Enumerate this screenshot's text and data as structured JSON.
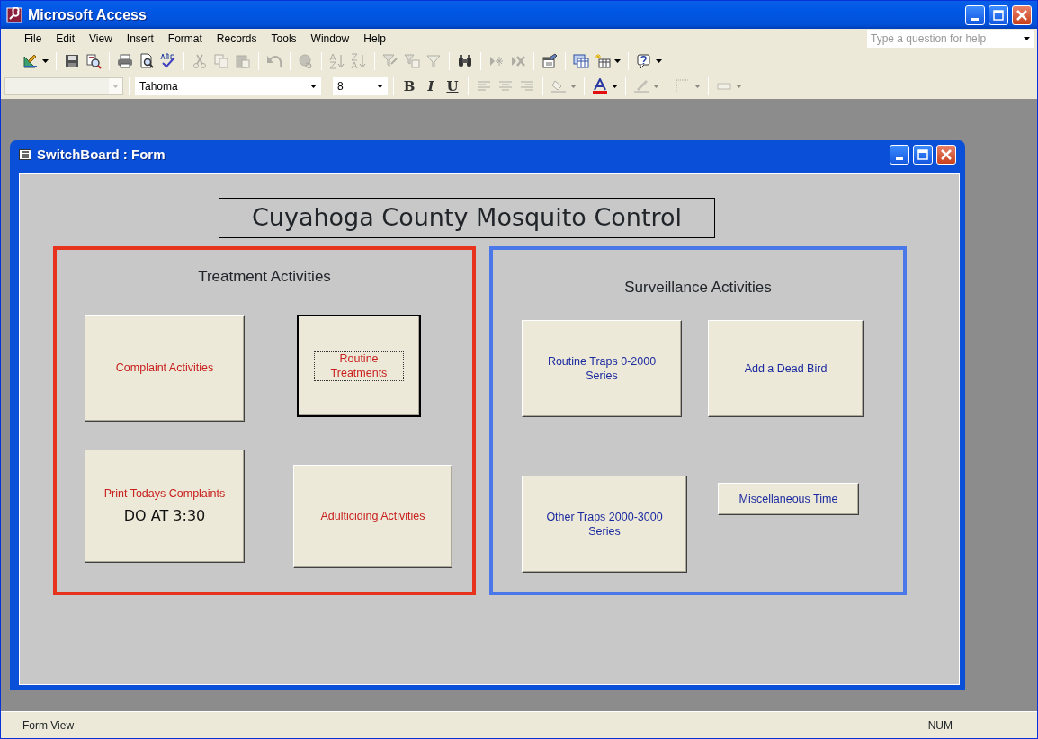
{
  "window": {
    "title": "Microsoft Access"
  },
  "menu": [
    "File",
    "Edit",
    "View",
    "Insert",
    "Format",
    "Records",
    "Tools",
    "Window",
    "Help"
  ],
  "help_box": {
    "placeholder": "Type a question for help"
  },
  "toolbar": {
    "groups": [
      [
        {
          "kind": "design",
          "disabled": false
        }
      ],
      [
        {
          "kind": "save",
          "disabled": false
        },
        {
          "kind": "filesearch",
          "disabled": false
        }
      ],
      [
        {
          "kind": "print",
          "disabled": false
        },
        {
          "kind": "preview",
          "disabled": false
        },
        {
          "kind": "spelling",
          "disabled": false
        }
      ],
      [
        {
          "kind": "cut",
          "disabled": true
        },
        {
          "kind": "copy",
          "disabled": true
        },
        {
          "kind": "paste",
          "disabled": true
        }
      ],
      [
        {
          "kind": "undo",
          "disabled": true
        }
      ],
      [
        {
          "kind": "hyperlink",
          "disabled": true
        }
      ],
      [
        {
          "kind": "sortasc",
          "disabled": true
        },
        {
          "kind": "sortdesc",
          "disabled": true
        }
      ],
      [
        {
          "kind": "filtersel",
          "disabled": true
        },
        {
          "kind": "filterform",
          "disabled": true
        },
        {
          "kind": "filter",
          "disabled": true
        }
      ],
      [
        {
          "kind": "find",
          "disabled": false
        }
      ],
      [
        {
          "kind": "newrecord",
          "disabled": true
        },
        {
          "kind": "deleterecord",
          "disabled": true
        }
      ],
      [
        {
          "kind": "properties",
          "disabled": false
        }
      ],
      [
        {
          "kind": "dbwindow",
          "disabled": false
        },
        {
          "kind": "newobject",
          "disabled": false
        }
      ],
      [
        {
          "kind": "help",
          "disabled": false
        }
      ]
    ]
  },
  "format_toolbar": {
    "object_box": {
      "disabled": true
    },
    "font_box": {
      "value": "Tahoma"
    },
    "size_box": {
      "value": "8"
    },
    "style_buttons": [
      "B",
      "I",
      "U"
    ],
    "groups": [
      [
        {
          "kind": "alignleft",
          "disabled": true
        },
        {
          "kind": "aligncenter",
          "disabled": true
        },
        {
          "kind": "alignright",
          "disabled": true
        }
      ],
      [
        {
          "kind": "fillcolor",
          "disabled": true
        }
      ],
      [
        {
          "kind": "fontcolor",
          "disabled": false
        }
      ],
      [
        {
          "kind": "linecolor",
          "disabled": true
        }
      ],
      [
        {
          "kind": "border",
          "disabled": true
        }
      ],
      [
        {
          "kind": "effect",
          "disabled": true
        }
      ]
    ]
  },
  "form_window": {
    "title": "SwitchBoard : Form",
    "heading": "Cuyahoga County Mosquito Control",
    "frames": [
      {
        "title": "Treatment Activities",
        "color": "#e8331c",
        "buttons": [
          {
            "label": "Complaint Activities",
            "color": "#c8201e",
            "focused": false
          },
          {
            "label": "Routine Treatments",
            "color": "#c8201e",
            "focused": true
          },
          {
            "label": "Print Todays Complaints",
            "color": "#c8201e",
            "focused": false,
            "note": "DO AT 3:30"
          },
          {
            "label": "Adulticiding Activities",
            "color": "#c8201e",
            "focused": false
          }
        ]
      },
      {
        "title": "Surveillance Activities",
        "color": "#4a78e8",
        "buttons": [
          {
            "label": "Routine Traps 0-2000 Series",
            "color": "#1c2aa0",
            "focused": false
          },
          {
            "label": "Add a Dead Bird",
            "color": "#1c2aa0",
            "focused": false
          },
          {
            "label": "Other Traps 2000-3000 Series",
            "color": "#1c2aa0",
            "focused": false
          },
          {
            "label": "Miscellaneous Time",
            "color": "#1c2aa0",
            "focused": false
          }
        ]
      }
    ]
  },
  "status_bar": {
    "left": "Form View",
    "right": "NUM"
  }
}
